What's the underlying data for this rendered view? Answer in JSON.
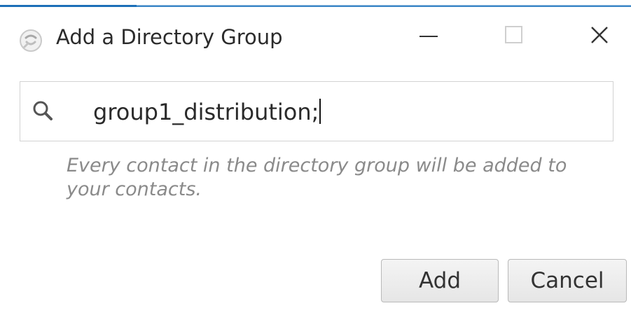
{
  "window": {
    "title": "Add a Directory Group",
    "icon": "app-logo-icon",
    "accent_color": "#1c6fb8"
  },
  "title_bar": {
    "minimize_icon": "minimize-icon",
    "maximize_icon": "maximize-icon",
    "close_icon": "close-icon"
  },
  "search": {
    "icon": "search-icon",
    "value": "group1_distribution;"
  },
  "hint": "Every contact in the directory group will be added to your contacts.",
  "buttons": {
    "add_label": "Add",
    "cancel_label": "Cancel"
  }
}
